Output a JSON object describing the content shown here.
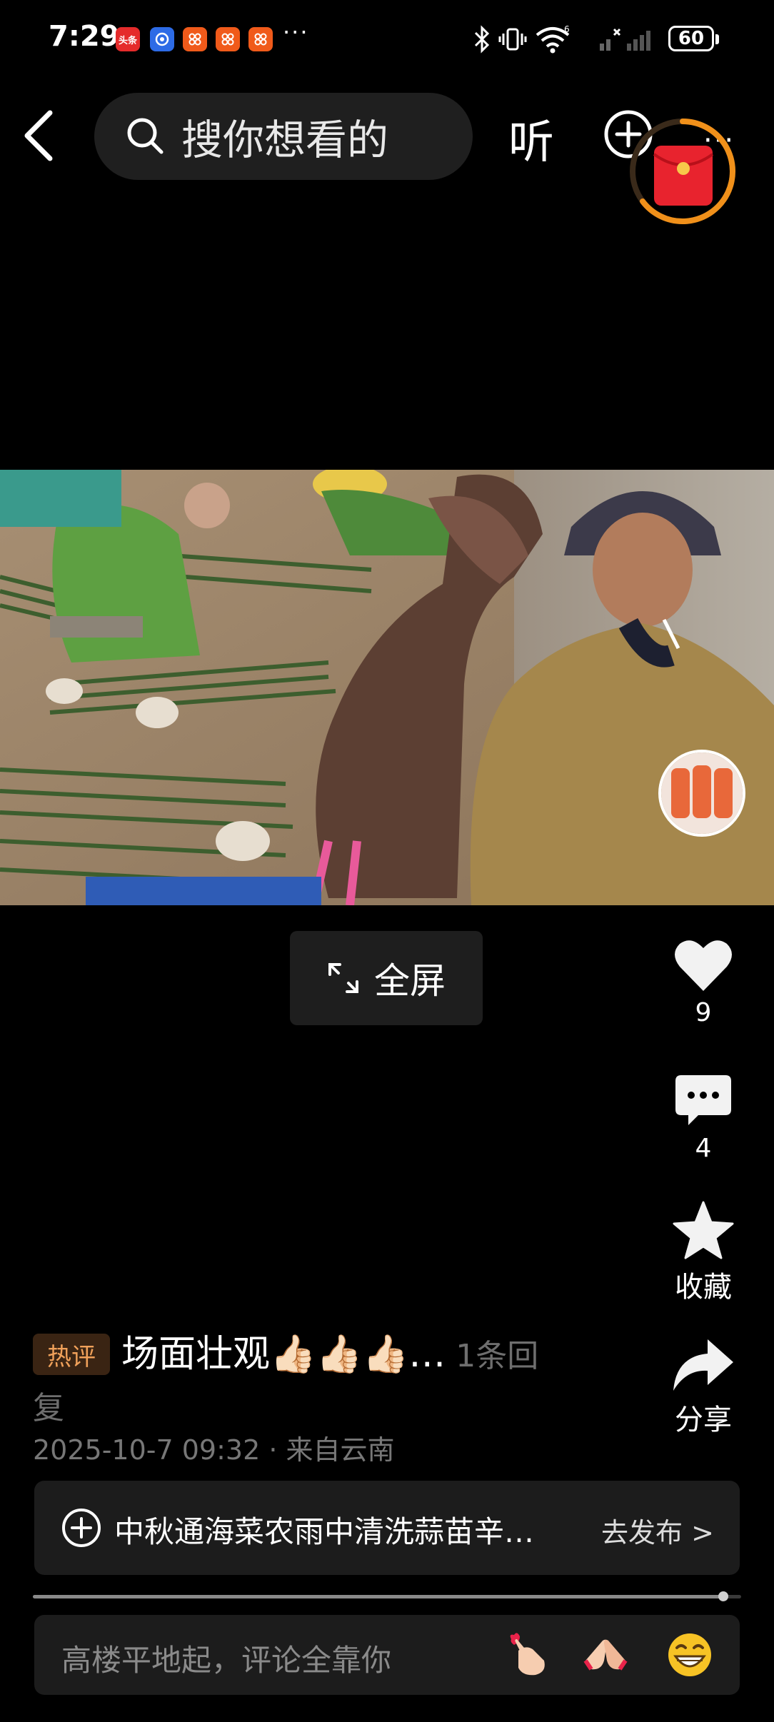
{
  "status_bar": {
    "time": "7:29",
    "app_badges": [
      "头条",
      "",
      "",
      "",
      ""
    ],
    "more": "···",
    "battery": "60"
  },
  "nav": {
    "search_placeholder": "搜你想看的",
    "listen_label": "听"
  },
  "video": {
    "fullscreen_label": "全屏"
  },
  "side_actions": {
    "like_count": "9",
    "comment_count": "4",
    "favorite_label": "收藏",
    "share_label": "分享"
  },
  "hot_comment": {
    "tag": "热评",
    "text": "场面壮观👍🏻👍🏻👍🏻…",
    "reply_prefix": " 1条回",
    "reply_suffix": "复",
    "meta": "2025-10-7 09:32 · 来自云南"
  },
  "publish_bar": {
    "text": "中秋通海菜农雨中清洗蒜苗辛…",
    "action": "去发布 >"
  },
  "progress": {
    "fraction": 0.975
  },
  "comment_input": {
    "placeholder": "高楼平地起，评论全靠你"
  },
  "colors": {
    "background": "#000000",
    "hot_tag_text": "#f0a15a",
    "redpacket": "#e8232e",
    "ring": "#f0901a"
  },
  "icons": [
    "back-icon",
    "search-icon",
    "add-circle-icon",
    "redpacket-icon",
    "fullscreen-icon",
    "heart-icon",
    "comment-icon",
    "star-icon",
    "share-icon",
    "emoji-finger-heart-icon",
    "emoji-hands-icon",
    "emoji-grin-icon"
  ]
}
